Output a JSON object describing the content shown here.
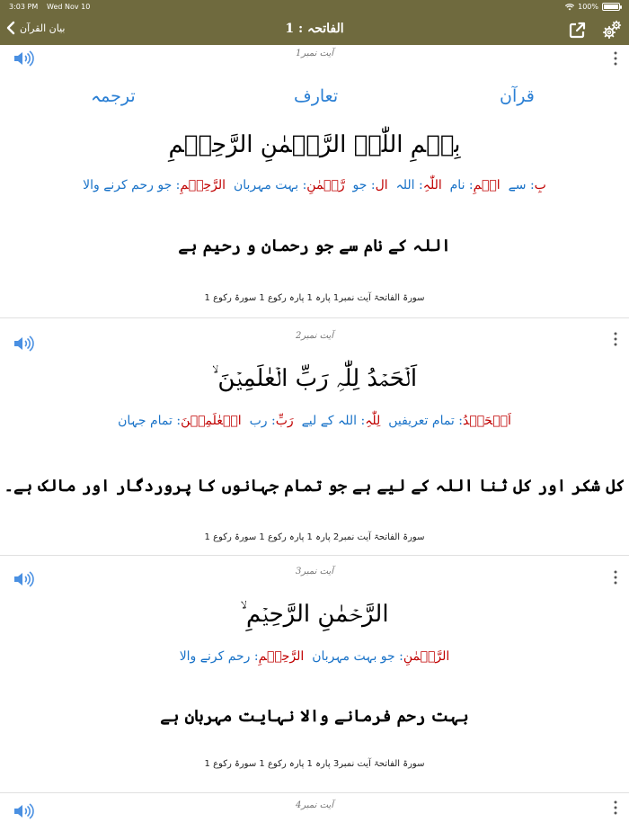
{
  "status_bar": {
    "time": "3:03 PM",
    "date": "Wed Nov 10",
    "battery": "100%"
  },
  "nav": {
    "back_label": "بیان القرآن",
    "title": "الفاتحہ : 1",
    "icons": [
      "share-icon",
      "settings-gears-icon"
    ]
  },
  "tabs": {
    "quran": "قرآن",
    "taaruf": "تعارف",
    "tarjuma": "ترجمہ"
  },
  "verses": [
    {
      "ayah_label": "آیت نمبر1",
      "arabic": "بِسۡمِ اللّٰہِ الرَّحۡمٰنِ الرَّحِیۡمِ",
      "word_by_word": [
        {
          "ar": "بِ",
          "ur": ": سے"
        },
        {
          "ar": "اسۡمِ",
          "ur": ": نام"
        },
        {
          "ar": "اللّٰہِ",
          "ur": ": اللہ"
        },
        {
          "ar": "ال",
          "ur": ": جو"
        },
        {
          "ar": "رَّحۡمٰنِ",
          "ur": ": بہت مہربان"
        },
        {
          "ar": "الرَّحِیۡمِ",
          "ur": ": جو رحم کرنے والا"
        }
      ],
      "translation": "اللہ کے نام سے جو رحمان و رحیم ہے",
      "meta": "سورۃ الفاتحۃ آیت نمبر1  پارہ 1 پارہ رکوع 1 سورۃ رکوع 1"
    },
    {
      "ayah_label": "آیت نمبر2",
      "arabic": "اَلۡحَمۡدُ لِلّٰہِ رَبِّ الۡعٰلَمِیۡنَ ۙ",
      "word_by_word": [
        {
          "ar": "اَلۡحَمۡدُ",
          "ur": ": تمام تعریفیں"
        },
        {
          "ar": "لِلّٰہِ",
          "ur": ": اللہ کے لیے"
        },
        {
          "ar": "رَبِّ",
          "ur": ": رب"
        },
        {
          "ar": "الۡعٰلَمِیۡنَ",
          "ur": ": تمام جہان"
        }
      ],
      "translation": "کل شکر اور کل ثنا اللہ کے لیے ہے جو تمام جہانوں کا پروردگار اور مالک ہے۔",
      "meta": "سورۃ الفاتحۃ آیت نمبر2  پارہ 1 پارہ رکوع 1 سورۃ رکوع 1"
    },
    {
      "ayah_label": "آیت نمبر3",
      "arabic": "الرَّحۡمٰنِ الرَّحِیۡمِ ۙ",
      "word_by_word": [
        {
          "ar": "الرَّحۡمٰنِ",
          "ur": ": جو بہت مہربان"
        },
        {
          "ar": "الرَّحِیۡمِ",
          "ur": ": رحم کرنے والا"
        }
      ],
      "translation": "بہت رحم فرمانے والا نہایت مہربان ہے",
      "meta": "سورۃ الفاتحۃ آیت نمبر3  پارہ 1 پارہ رکوع 1 سورۃ رکوع 1"
    },
    {
      "ayah_label": "آیت نمبر4"
    }
  ],
  "colors": {
    "nav_background": "#6f6a3e",
    "tab_blue": "#2a7fd4",
    "arabic_word_red": "#c00000",
    "urdu_meaning_blue": "#1a73c8",
    "speaker_blue": "#4a90e2"
  }
}
